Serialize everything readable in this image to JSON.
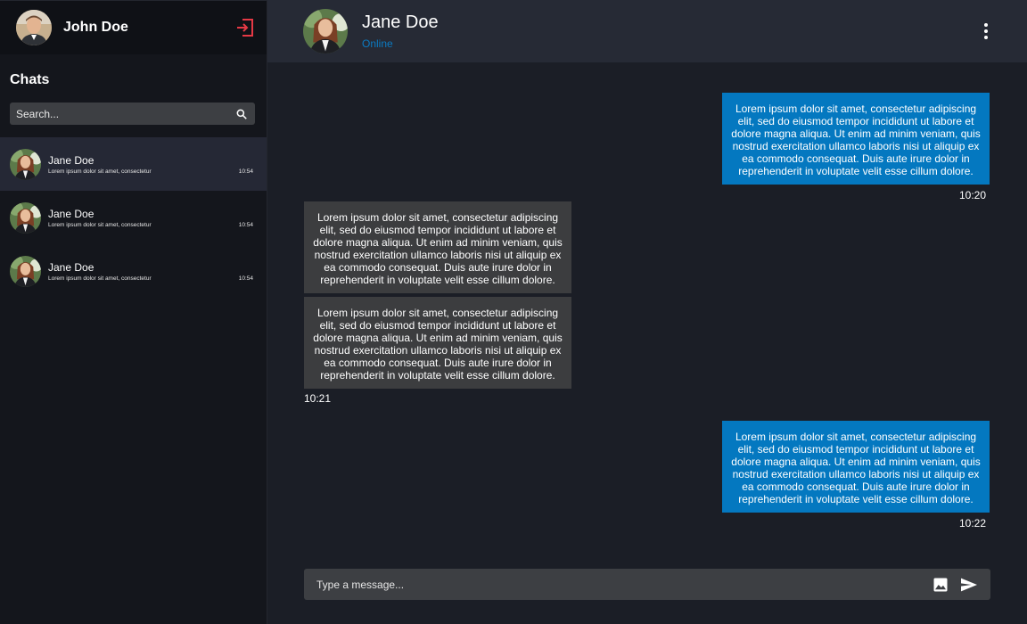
{
  "current_user": {
    "name": "John Doe"
  },
  "sidebar": {
    "title": "Chats",
    "search_placeholder": "Search...",
    "chats": [
      {
        "name": "Jane Doe",
        "preview": "Lorem ipsum dolor sit amet, consectetur",
        "time": "10:54",
        "active": true
      },
      {
        "name": "Jane Doe",
        "preview": "Lorem ipsum dolor sit amet, consectetur",
        "time": "10:54",
        "active": false
      },
      {
        "name": "Jane Doe",
        "preview": "Lorem ipsum dolor sit amet, consectetur",
        "time": "10:54",
        "active": false
      }
    ]
  },
  "conversation": {
    "contact_name": "Jane Doe",
    "contact_status": "Online",
    "messages": [
      {
        "direction": "outgoing",
        "text": "Lorem ipsum dolor sit amet, consectetur adipiscing elit, sed do eiusmod tempor incididunt ut labore et dolore magna aliqua. Ut enim ad minim veniam, quis nostrud exercitation ullamco laboris nisi ut aliquip ex ea commodo consequat. Duis aute irure dolor in reprehenderit in voluptate velit esse cillum dolore.",
        "time": "10:20"
      },
      {
        "direction": "incoming",
        "text": "Lorem ipsum dolor sit amet, consectetur adipiscing elit, sed do eiusmod tempor incididunt ut labore et dolore magna aliqua. Ut enim ad minim veniam, quis nostrud exercitation ullamco laboris nisi ut aliquip ex ea commodo consequat. Duis aute irure dolor in reprehenderit in voluptate velit esse cillum dolore.",
        "time": ""
      },
      {
        "direction": "incoming",
        "text": "Lorem ipsum dolor sit amet, consectetur adipiscing elit, sed do eiusmod tempor incididunt ut labore et dolore magna aliqua. Ut enim ad minim veniam, quis nostrud exercitation ullamco laboris nisi ut aliquip ex ea commodo consequat. Duis aute irure dolor in reprehenderit in voluptate velit esse cillum dolore.",
        "time": "10:21"
      },
      {
        "direction": "outgoing",
        "text": "Lorem ipsum dolor sit amet, consectetur adipiscing elit, sed do eiusmod tempor incididunt ut labore et dolore magna aliqua. Ut enim ad minim veniam, quis nostrud exercitation ullamco laboris nisi ut aliquip ex ea commodo consequat. Duis aute irure dolor in reprehenderit in voluptate velit esse cillum dolore.",
        "time": "10:22"
      }
    ]
  },
  "composer": {
    "placeholder": "Type a message..."
  },
  "colors": {
    "accent": "#0478c0",
    "logout": "#e53945",
    "status_online": "#0b7bc2",
    "incoming_bubble": "#3c3d3f"
  },
  "icons": {
    "logout": "logout-icon",
    "search": "search-icon",
    "menu": "more-vertical-icon",
    "image": "image-icon",
    "send": "send-icon"
  }
}
